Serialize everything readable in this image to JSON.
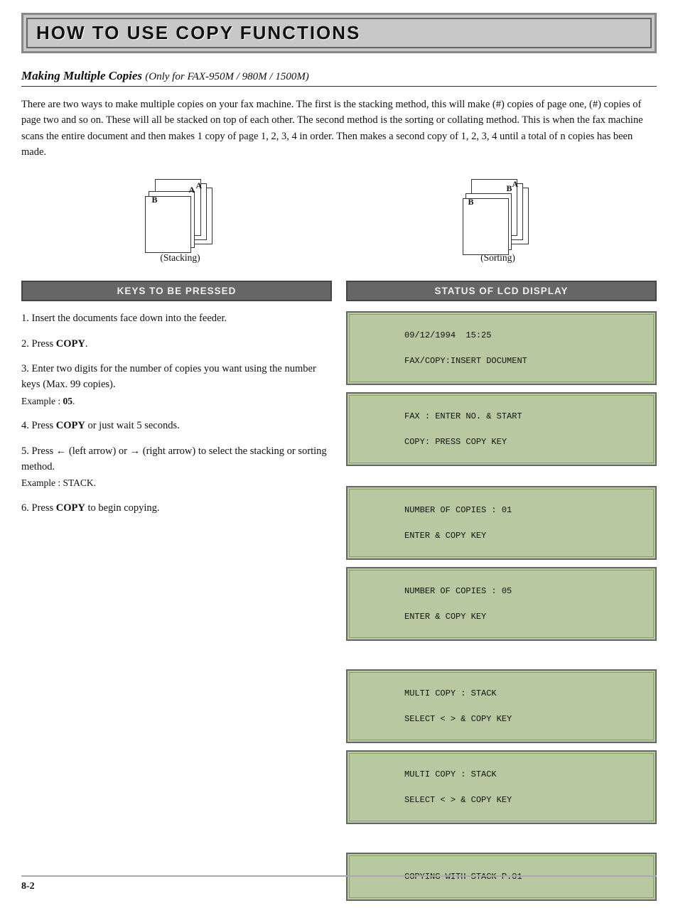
{
  "header": {
    "title": "HOW TO USE COPY FUNCTIONS"
  },
  "section": {
    "title": "Making Multiple Copies",
    "subtitle": "(Only for FAX-950M / 980M / 1500M)"
  },
  "body_text": "There are two ways to make multiple copies on your fax machine. The first is the stacking method, this will make (#) copies of page one, (#) copies of page two and so on. These will all be stacked on top of each other. The second method is the sorting or collating method. This is when the fax machine scans the entire document and then makes 1 copy of page 1, 2, 3, 4 in order. Then makes a second copy of 1, 2, 3, 4 until a total of n copies has been made.",
  "diagrams": [
    {
      "label": "(Stacking)"
    },
    {
      "label": "(Sorting)"
    }
  ],
  "keys_header": "KEYS TO BE PRESSED",
  "status_header": "STATUS OF LCD DISPLAY",
  "steps": [
    {
      "number": "1.",
      "text": "Insert the documents face down into the feeder."
    },
    {
      "number": "2.",
      "text": "Press ",
      "bold": "COPY",
      "after": "."
    },
    {
      "number": "3.",
      "text": "Enter two digits for the number of copies you want using the number keys (Max. 99 copies).",
      "example": "Example : 05."
    },
    {
      "number": "4.",
      "text": "Press ",
      "bold": "COPY",
      "after": " or just wait 5 seconds."
    },
    {
      "number": "5.",
      "text": "Press ← (left arrow) or → (right arrow) to select the stacking or sorting method.",
      "example": "Example : STACK."
    },
    {
      "number": "6.",
      "text": "Press ",
      "bold": "COPY",
      "after": " to begin copying."
    }
  ],
  "lcd_displays": [
    {
      "id": "lcd1",
      "lines": [
        "09/12/1994  15:25",
        "FAX/COPY:INSERT DOCUMENT"
      ]
    },
    {
      "id": "lcd2",
      "lines": [
        "FAX : ENTER NO. & START",
        "COPY: PRESS COPY KEY"
      ]
    },
    {
      "id": "lcd3",
      "lines": [
        "NUMBER OF COPIES : 01",
        "ENTER & COPY KEY"
      ]
    },
    {
      "id": "lcd4",
      "lines": [
        "NUMBER OF COPIES : 05",
        "ENTER & COPY KEY"
      ]
    },
    {
      "id": "lcd5",
      "lines": [
        "MULTI COPY : STACK",
        "SELECT < > & COPY KEY"
      ]
    },
    {
      "id": "lcd6",
      "lines": [
        "MULTI COPY : STACK",
        "SELECT < > & COPY KEY"
      ]
    },
    {
      "id": "lcd7",
      "lines": [
        "COPYING WITH STACK P.01"
      ]
    }
  ],
  "page_number": "8-2"
}
